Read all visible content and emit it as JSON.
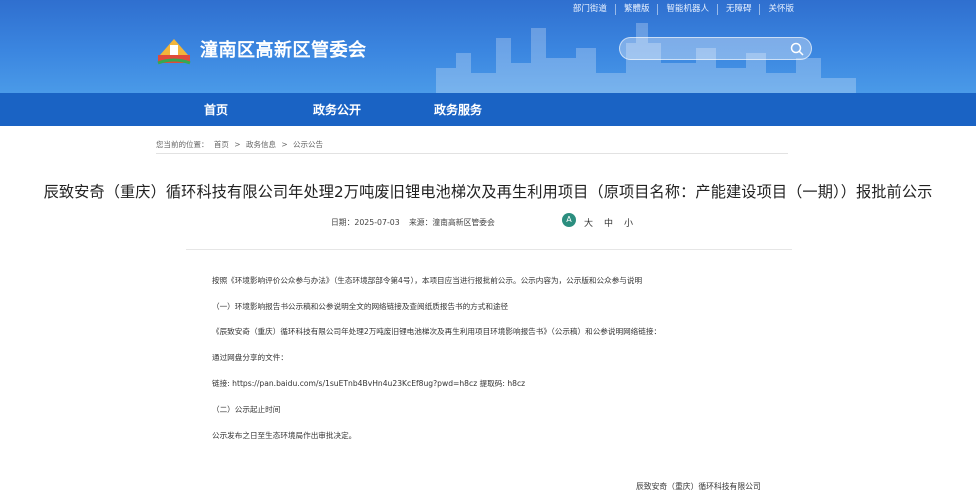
{
  "toplinks": [
    "部门街道",
    "繁體版",
    "智能机器人",
    "无障碍",
    "关怀版"
  ],
  "site_title": "潼南区高新区管委会",
  "search": {
    "placeholder": ""
  },
  "nav": [
    "首页",
    "政务公开",
    "政务服务"
  ],
  "breadcrumb": [
    "您当前的位置：",
    "首页",
    ">",
    "政务信息",
    ">",
    "公示公告"
  ],
  "article": {
    "title": "辰致安奇（重庆）循环科技有限公司年处理2万吨废旧锂电池梯次及再生利用项目（原项目名称：产能建设项目（一期））报批前公示",
    "date": "日期：2025-07-03",
    "source": "来源：潼南高新区管委会",
    "font_sizes": [
      "大",
      "中",
      "小"
    ],
    "font_icon": "A",
    "paragraphs": [
      "按照《环境影响评价公众参与办法》（生态环境部部令第4号），本项目应当进行报批前公示。公示内容为，公示版和公众参与说明",
      "（一）环境影响报告书公示稿和公参说明全文的网络链接及查阅纸质报告书的方式和途径",
      "《辰致安奇（重庆）循环科技有限公司年处理2万吨废旧锂电池梯次及再生利用项目环境影响报告书》（公示稿）和公参说明网络链接：",
      "通过网盘分享的文件：",
      "链接: https://pan.baidu.com/s/1suETnb4BvHn4u23KcEf8ug?pwd=h8cz 提取码: h8cz",
      "（二）公示起止时间",
      "公示发布之日至生态环境局作出审批决定。"
    ],
    "signature": "辰致安奇（重庆）循环科技有限公司"
  },
  "colors": {
    "header": "#3b86e0",
    "nav": "#1a63c4",
    "font_icon": "#2b8e7f"
  }
}
